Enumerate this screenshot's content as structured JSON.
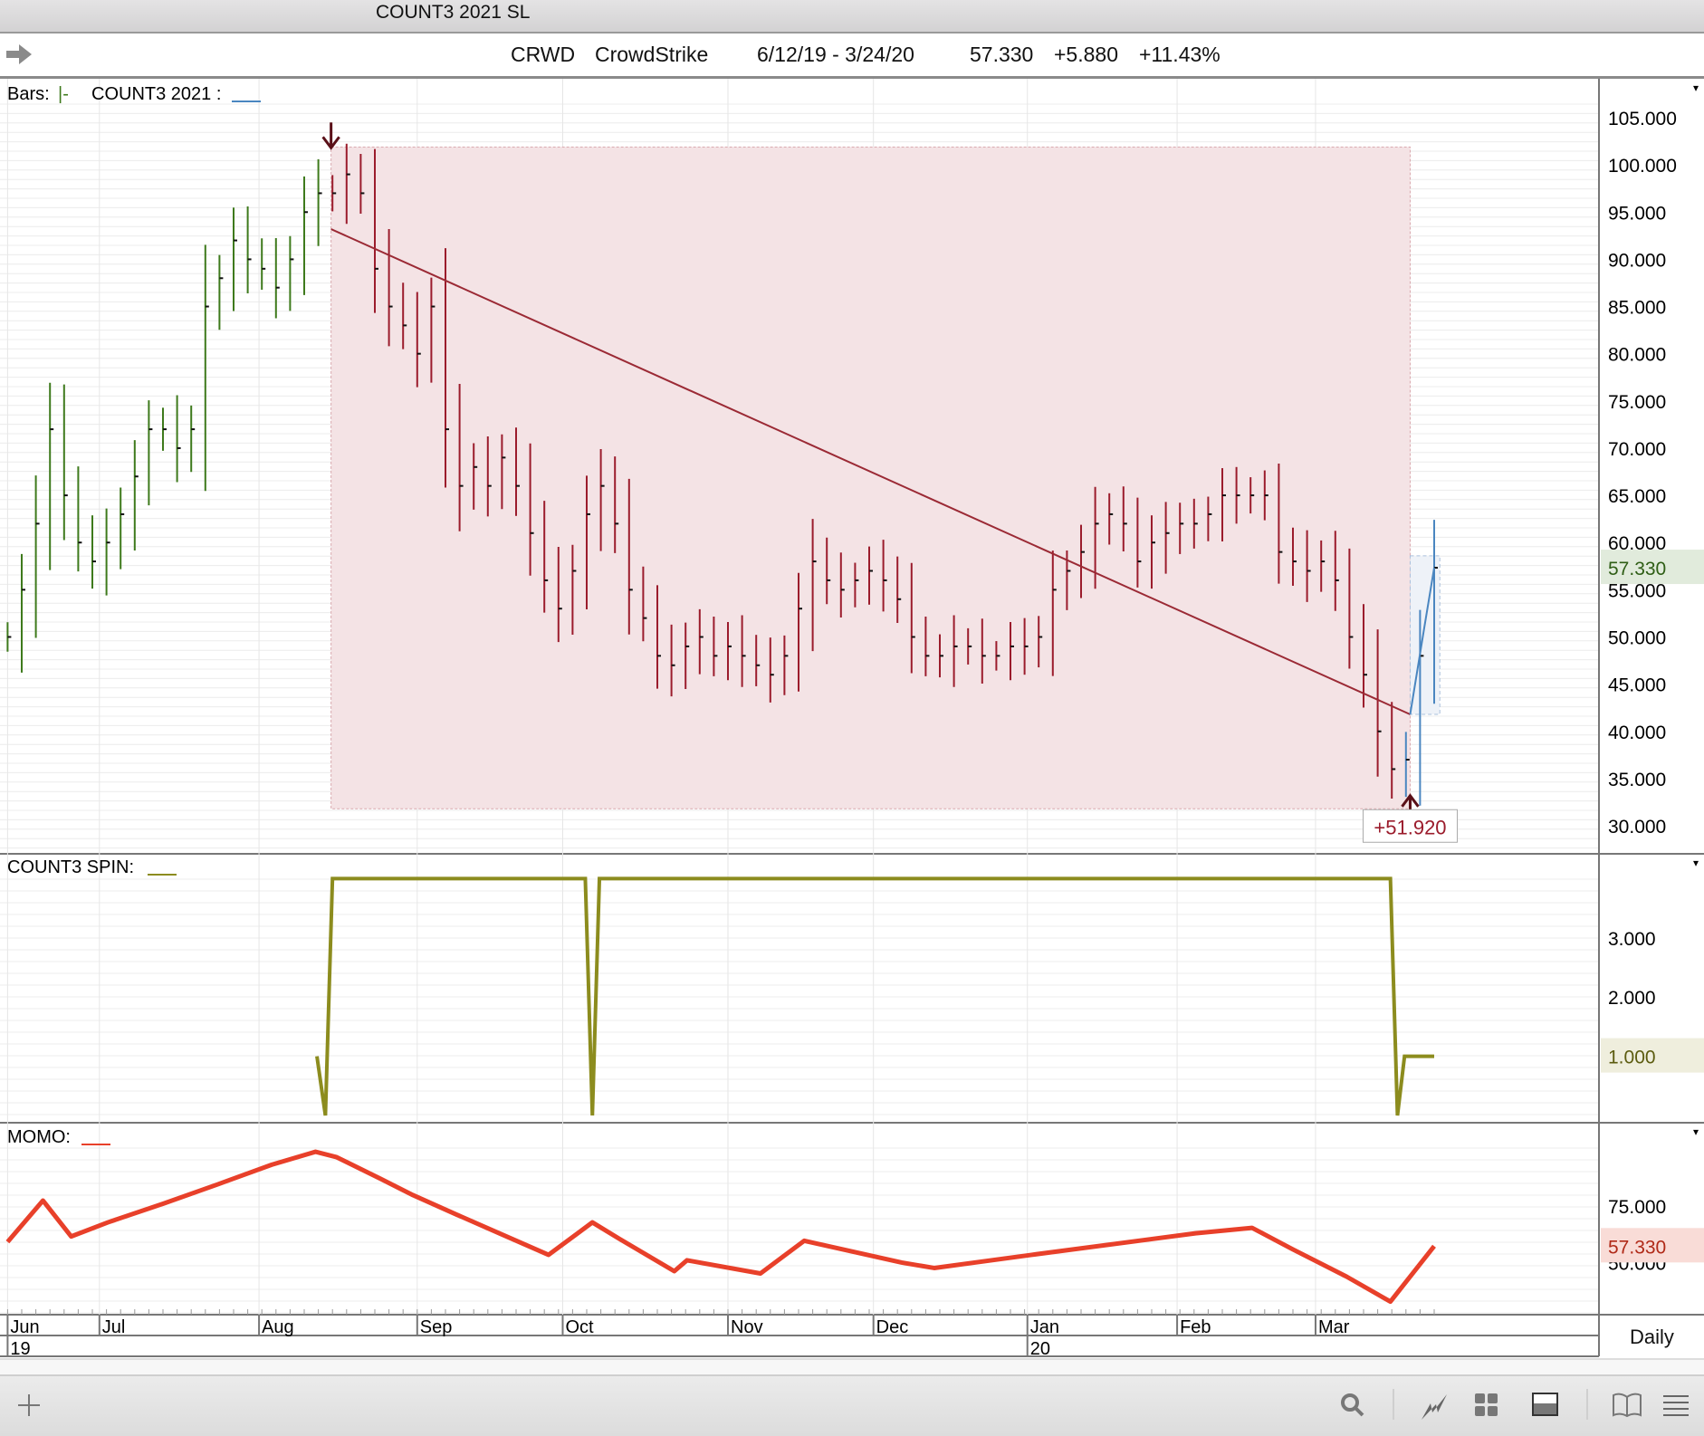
{
  "window": {
    "title": "COUNT3 2021 SL"
  },
  "info": {
    "symbol": "CRWD",
    "name": "CrowdStrike",
    "range": "6/12/19 - 3/24/20",
    "last": "57.330",
    "change": "+5.880",
    "pct": "+11.43%"
  },
  "panels": {
    "price_legend": {
      "bars": "Bars:",
      "bars_symbol": "|-",
      "indicator": "COUNT3 2021 :"
    },
    "spin_legend": "COUNT3 SPIN:",
    "momo_legend": "MOMO:",
    "timeframe": "Daily"
  },
  "colors": {
    "up": "#3e7a1c",
    "down": "#9b1c2c",
    "recent": "#4a86c0",
    "spin": "#8c8c1e",
    "momo": "#e8402a",
    "zone": "#f4e3e5"
  },
  "chart_data": [
    {
      "type": "bar",
      "title": "CRWD price bars",
      "ylim": [
        28,
        107
      ],
      "yticks": [
        "105.000",
        "100.000",
        "95.000",
        "90.000",
        "85.000",
        "80.000",
        "75.000",
        "70.000",
        "65.000",
        "60.000",
        "55.000",
        "50.000",
        "45.000",
        "40.000",
        "35.000",
        "30.000"
      ],
      "last_label": "57.330",
      "closes": [
        50,
        55,
        62,
        72,
        65,
        60,
        58,
        60,
        63,
        67,
        72,
        72,
        70,
        72,
        85,
        88,
        92,
        90,
        89,
        87,
        90,
        95,
        97,
        97,
        99,
        97,
        89,
        85,
        83,
        80,
        85,
        72,
        66,
        68,
        66,
        69,
        66,
        61,
        56,
        53,
        57,
        63,
        66,
        62,
        55,
        52,
        48,
        47,
        49,
        50,
        48,
        49,
        48,
        47,
        46,
        48,
        53,
        58,
        56,
        55,
        56,
        57,
        56,
        54,
        50,
        48,
        48,
        49,
        49,
        48,
        48,
        49,
        49,
        50,
        55,
        57,
        59,
        62,
        63,
        62,
        58,
        60,
        61,
        62,
        62,
        63,
        65,
        65,
        65,
        65,
        59,
        58,
        57,
        58,
        56,
        50,
        46,
        40,
        36,
        37,
        48,
        57.33
      ],
      "up_until_index": 22,
      "recent_from_index": 100,
      "trend_line": {
        "from": [
          22.9,
          93.2
        ],
        "to": [
          99.3,
          41.8
        ]
      },
      "zone": {
        "x": [
          22.9,
          99.3
        ],
        "y": [
          31.8,
          101.9
        ],
        "gain_label": "+51.920"
      },
      "recent_box": {
        "x": [
          99.3,
          101.4
        ],
        "y": [
          41.8,
          58.6
        ]
      }
    },
    {
      "type": "line",
      "title": "COUNT3 SPIN",
      "ylim": [
        0,
        4.4
      ],
      "yticks": [
        "3.000",
        "2.000",
        "1.000"
      ],
      "last_label": "1.000",
      "x": [
        21.9,
        22.5,
        23.0,
        40.9,
        41.4,
        41.9,
        97.9,
        98.4,
        98.9,
        101
      ],
      "y": [
        1,
        0,
        4,
        4,
        0,
        4,
        4,
        0,
        1,
        1
      ]
    },
    {
      "type": "line",
      "title": "MOMO",
      "ylim": [
        25,
        105
      ],
      "yticks": [
        "75.000",
        "50.000"
      ],
      "last_label": "57.330",
      "x": [
        0,
        2.5,
        4.5,
        7.1,
        11,
        14.9,
        18.7,
        21.8,
        23.3,
        26.4,
        28.7,
        31.8,
        34.8,
        38.3,
        41.4,
        43.3,
        47.2,
        48.1,
        53.3,
        56.4,
        63.3,
        65.6,
        72.5,
        84.1,
        88.1,
        91,
        94.8,
        97.9,
        101
      ],
      "y": [
        59.2,
        77.4,
        61.6,
        67.8,
        76,
        84.6,
        93.2,
        98.9,
        96.5,
        87,
        79.8,
        71.2,
        63,
        53.5,
        67.8,
        60.6,
        46.3,
        51.1,
        45.3,
        59.7,
        50.1,
        47.7,
        53.5,
        63,
        65.4,
        55.9,
        43.9,
        32.9,
        57.33
      ]
    }
  ],
  "x_axis": {
    "months": [
      {
        "label": "Jun",
        "sub": "19",
        "index": 0
      },
      {
        "label": "Jul",
        "index": 6.5
      },
      {
        "label": "Aug",
        "index": 17.8
      },
      {
        "label": "Sep",
        "index": 29
      },
      {
        "label": "Oct",
        "index": 39.3
      },
      {
        "label": "Nov",
        "index": 51
      },
      {
        "label": "Dec",
        "index": 61.3
      },
      {
        "label": "Jan",
        "sub": "20",
        "index": 72.2
      },
      {
        "label": "Feb",
        "index": 82.8
      },
      {
        "label": "Mar",
        "index": 92.6
      }
    ]
  },
  "toolbar": [
    "add-icon",
    "search-icon",
    "draw-icon",
    "grid-icon",
    "panel-icon",
    "book-icon",
    "menu-icon"
  ]
}
